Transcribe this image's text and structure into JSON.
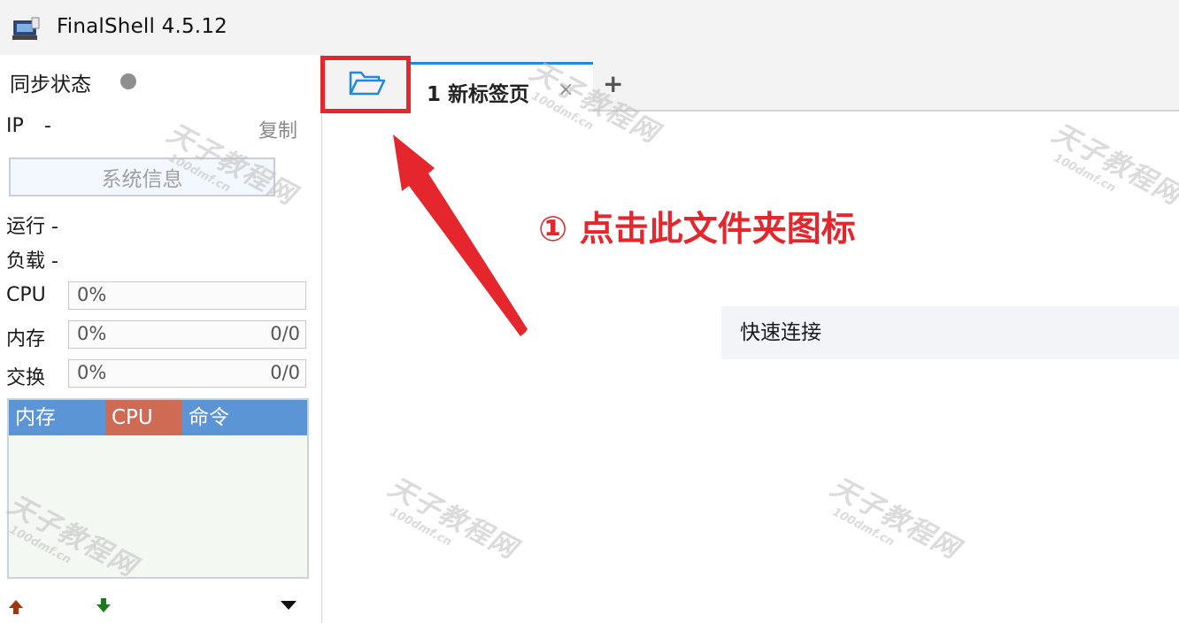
{
  "window": {
    "title": "FinalShell 4.5.12"
  },
  "sidebar": {
    "sync_label": "同步状态",
    "ip_label": "IP",
    "ip_value": "-",
    "copy_label": "复制",
    "sysinfo_button": "系统信息",
    "uptime": "运行 -",
    "load": "负载 -",
    "meters": [
      {
        "label": "CPU",
        "percent": "0%",
        "ratio": ""
      },
      {
        "label": "内存",
        "percent": "0%",
        "ratio": "0/0"
      },
      {
        "label": "交换",
        "percent": "0%",
        "ratio": "0/0"
      }
    ],
    "process_table": {
      "columns": [
        "内存",
        "CPU",
        "命令"
      ]
    }
  },
  "tabs": {
    "items": [
      {
        "label": "1  新标签页"
      }
    ],
    "close_glyph": "×",
    "add_glyph": "+"
  },
  "main": {
    "quick_connect": "快速连接"
  },
  "annotation": {
    "text": "① 点击此文件夹图标"
  },
  "watermark": {
    "main": "天子教程网",
    "sub": "100dmf.cn"
  },
  "colors": {
    "accent": "#1e88e5",
    "annotation_red": "#e5272d",
    "header_blue": "#5b95d6",
    "header_cpu": "#cf6a55",
    "sync_dot": "#8e8e8e"
  },
  "icons": {
    "app": "monitor-icon",
    "folder": "folder-open-icon",
    "upload": "arrow-up-icon",
    "download": "arrow-down-icon",
    "menu": "caret-down-icon"
  }
}
